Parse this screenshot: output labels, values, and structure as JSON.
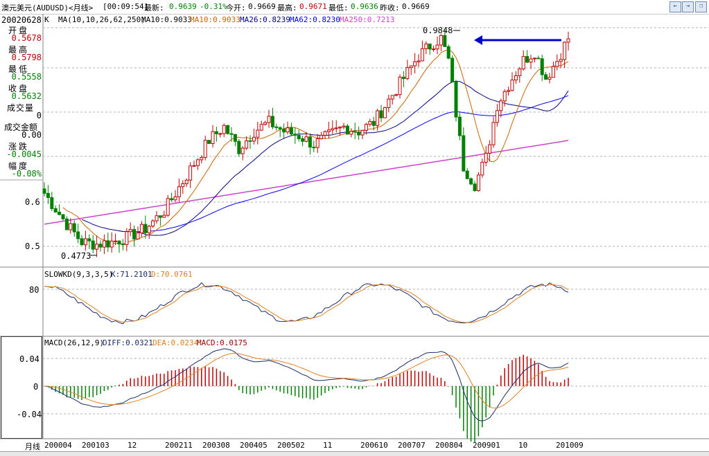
{
  "window": {
    "title": "澳元美元(AUDUSD)<月线>",
    "time": "[00:09:54]",
    "latest_label": "最新:",
    "latest_value": "0.9639",
    "change_pct": "-0.31%",
    "open_label": "今开:",
    "open_value": "0.9669",
    "high_label": "最高:",
    "high_value": "0.9671",
    "low_label": "最低:",
    "low_value": "0.9636",
    "prev_close_label": "昨收:",
    "prev_close_value": "0.9669",
    "buttons": [
      "back-icon",
      "forward-icon",
      "restore-icon"
    ]
  },
  "left_panel": {
    "date": "20020628",
    "open_label": "开盘",
    "open_value": "0.5678",
    "high_label": "最高",
    "high_value": "0.5798",
    "low_label": "最低",
    "low_value": "0.5558",
    "close_label": "收盘",
    "close_value": "0.5632",
    "volume_label": "成交量",
    "volume_value": "0",
    "amount_label": "成交金额",
    "amount_value": "0.00",
    "change_label": "涨跌",
    "change_value": "-0.0045",
    "amplitude_label": "幅度",
    "amplitude_value": "-0.08%"
  },
  "indicators": {
    "main_k": "K",
    "ma_header": "MA(10,10,26,62,250)",
    "ma10a": "MA10:0.9033",
    "ma10b": "MA10:0.9033",
    "ma26": "MA26:0.8239",
    "ma62": "MA62:0.8230",
    "ma250": "MA250:0.7213",
    "kd_header": "SLOWKD(9,3,3,5)",
    "kd_k": "K:71.2101",
    "kd_d": "D:70.0761",
    "macd_header": "MACD(26,12,9)",
    "macd_diff": "DIFF:0.0321",
    "macd_dea": "DEA:0.0234",
    "macd_macd": "MACD:0.0175",
    "y_label_main_1": "0.6",
    "y_label_main_2": "0.5",
    "y_label_kd": "80",
    "y_label_macd_1": "0.04",
    "y_label_macd_2": "0",
    "y_label_macd_3": "-0.04",
    "annot_high": "0.9848",
    "annot_low": "0.4773"
  },
  "x_axis": {
    "label": "月线",
    "ticks": [
      "200004",
      "200103",
      "12",
      "200211",
      "200308",
      "200405",
      "200502",
      "11",
      "200610",
      "200707",
      "200804",
      "200901",
      "10",
      "201009"
    ]
  },
  "colors": {
    "up": "#c00000",
    "down": "#008000",
    "ma10": "#c86400",
    "ma26": "#00008b",
    "ma62": "#0000ff",
    "ma250": "#cc44cc",
    "kd_k": "#1a2a6a",
    "kd_d": "#e08020",
    "arrow": "#0000cc"
  }
}
